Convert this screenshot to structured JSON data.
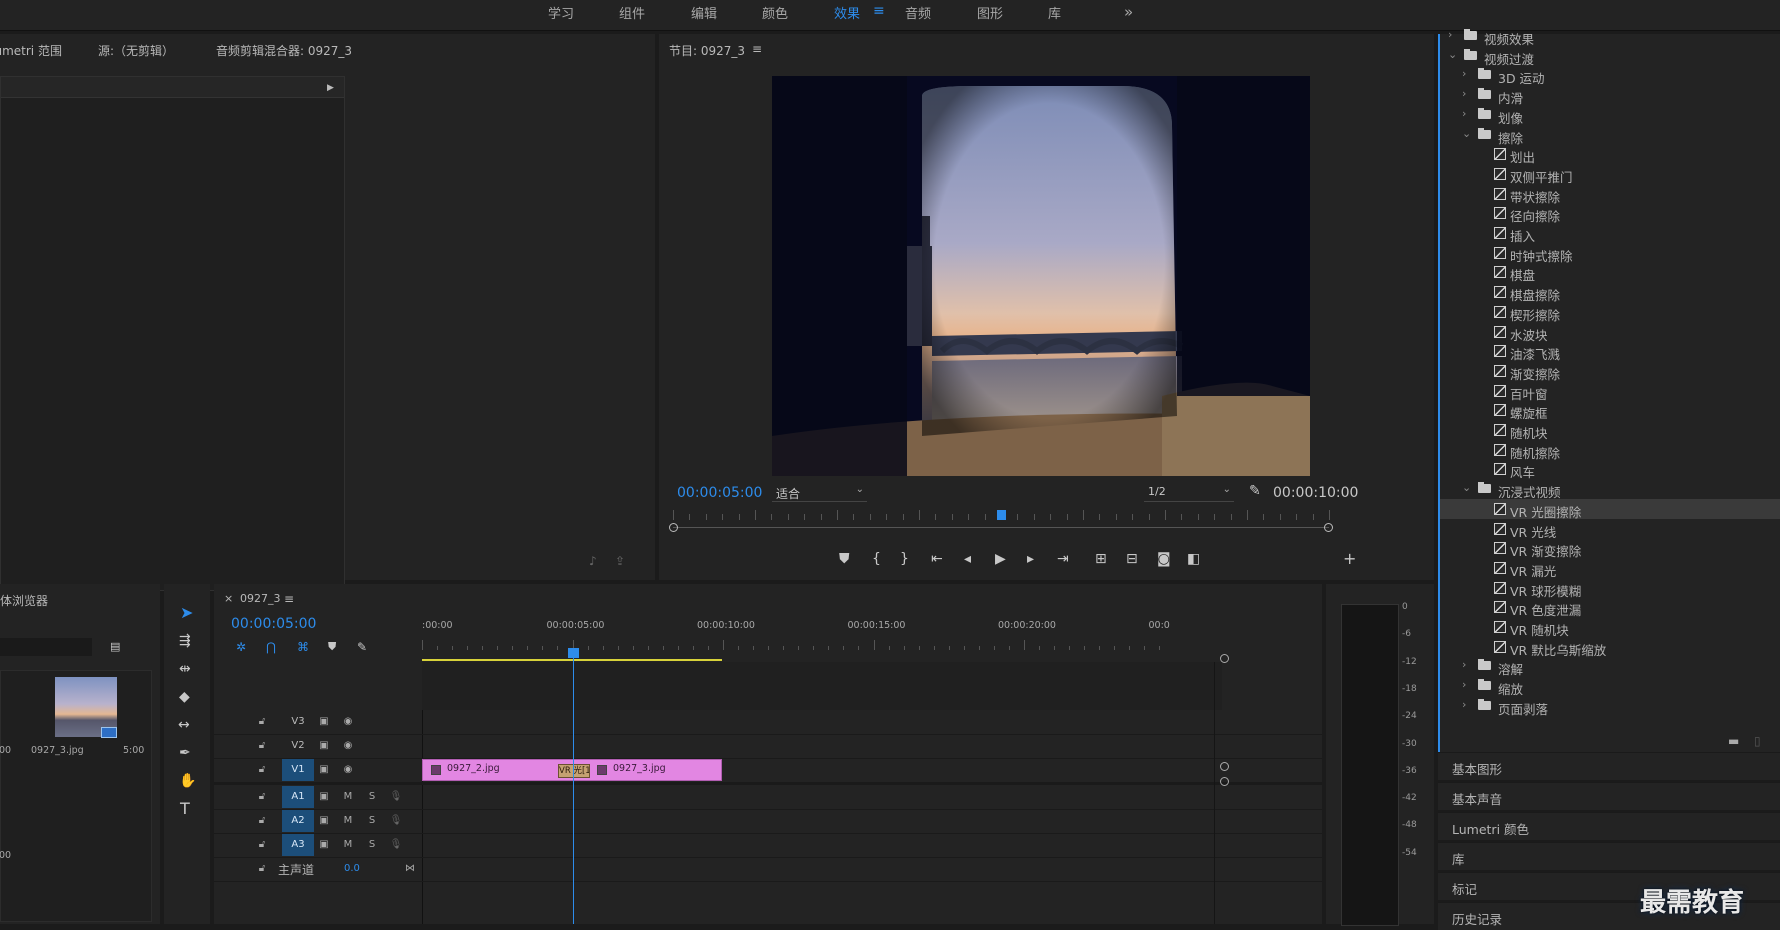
{
  "workspace_tabs": [
    "学习",
    "组件",
    "编辑",
    "颜色",
    "效果",
    "音频",
    "图形",
    "库"
  ],
  "active_workspace": "效果",
  "more_glyph": "»",
  "menu_glyph": "≡",
  "source_panel": {
    "tabs": [
      "Lumetri 范围",
      "源:（无剪辑）",
      "音频剪辑混合器: 0927_3"
    ]
  },
  "program_monitor": {
    "title": "节目: 0927_3",
    "current_time": "00:00:05:00",
    "fit_label": "适合",
    "resolution": "1/2",
    "duration": "00:00:10:00",
    "playhead_fraction": 0.5
  },
  "media_browser": {
    "title": "媒体浏览器",
    "item_name": "0927_3.jpg",
    "item_duration": "5:00",
    "left_dur": "00",
    "left_dur2": "00"
  },
  "timeline": {
    "tab_label": "0927_3",
    "close_glyph": "×",
    "current_time": "00:00:05:00",
    "ruler_labels": [
      ":00:00",
      "00:00:05:00",
      "00:00:10:00",
      "00:00:15:00",
      "00:00:20:00",
      "00:0"
    ],
    "tracks": [
      {
        "name": "V3",
        "type": "video",
        "target": false
      },
      {
        "name": "V2",
        "type": "video",
        "target": false
      },
      {
        "name": "V1",
        "type": "video",
        "target": true
      },
      {
        "name": "A1",
        "type": "audio",
        "target": true
      },
      {
        "name": "A2",
        "type": "audio",
        "target": true
      },
      {
        "name": "A3",
        "type": "audio",
        "target": true
      }
    ],
    "master_label": "主声道",
    "master_value": "0.0",
    "mute_label": "M",
    "solo_label": "S",
    "clips": [
      {
        "name": "0927_2.jpg",
        "track": "V1"
      },
      {
        "name": "0927_3.jpg",
        "track": "V1"
      }
    ],
    "transition_label": "VR 光",
    "transition_tail": "[1"
  },
  "audio_meter": {
    "scale": [
      "0",
      "-6",
      "-12",
      "-18",
      "-24",
      "-30",
      "-36",
      "-42",
      "-48",
      "-54"
    ]
  },
  "effects_tree": [
    {
      "level": 1,
      "type": "folder",
      "label": "视频效果",
      "expanded": false,
      "partial": true
    },
    {
      "level": 1,
      "type": "folder",
      "label": "视频过渡",
      "expanded": true
    },
    {
      "level": 2,
      "type": "folder",
      "label": "3D 运动",
      "expanded": false
    },
    {
      "level": 2,
      "type": "folder",
      "label": "内滑",
      "expanded": false
    },
    {
      "level": 2,
      "type": "folder",
      "label": "划像",
      "expanded": false
    },
    {
      "level": 2,
      "type": "folder",
      "label": "擦除",
      "expanded": true
    },
    {
      "level": 3,
      "type": "fx",
      "label": "划出"
    },
    {
      "level": 3,
      "type": "fx",
      "label": "双侧平推门"
    },
    {
      "level": 3,
      "type": "fx",
      "label": "带状擦除"
    },
    {
      "level": 3,
      "type": "fx",
      "label": "径向擦除"
    },
    {
      "level": 3,
      "type": "fx",
      "label": "插入"
    },
    {
      "level": 3,
      "type": "fx",
      "label": "时钟式擦除"
    },
    {
      "level": 3,
      "type": "fx",
      "label": "棋盘"
    },
    {
      "level": 3,
      "type": "fx",
      "label": "棋盘擦除"
    },
    {
      "level": 3,
      "type": "fx",
      "label": "楔形擦除"
    },
    {
      "level": 3,
      "type": "fx",
      "label": "水波块"
    },
    {
      "level": 3,
      "type": "fx",
      "label": "油漆飞溅"
    },
    {
      "level": 3,
      "type": "fx",
      "label": "渐变擦除"
    },
    {
      "level": 3,
      "type": "fx",
      "label": "百叶窗"
    },
    {
      "level": 3,
      "type": "fx",
      "label": "螺旋框"
    },
    {
      "level": 3,
      "type": "fx",
      "label": "随机块"
    },
    {
      "level": 3,
      "type": "fx",
      "label": "随机擦除"
    },
    {
      "level": 3,
      "type": "fx",
      "label": "风车"
    },
    {
      "level": 2,
      "type": "folder",
      "label": "沉浸式视频",
      "expanded": true
    },
    {
      "level": 3,
      "type": "fx",
      "label": "VR 光圈擦除",
      "selected": true
    },
    {
      "level": 3,
      "type": "fx",
      "label": "VR 光线"
    },
    {
      "level": 3,
      "type": "fx",
      "label": "VR 渐变擦除"
    },
    {
      "level": 3,
      "type": "fx",
      "label": "VR 漏光"
    },
    {
      "level": 3,
      "type": "fx",
      "label": "VR 球形模糊"
    },
    {
      "level": 3,
      "type": "fx",
      "label": "VR 色度泄漏"
    },
    {
      "level": 3,
      "type": "fx",
      "label": "VR 随机块"
    },
    {
      "level": 3,
      "type": "fx",
      "label": "VR 默比乌斯缩放"
    },
    {
      "level": 2,
      "type": "folder",
      "label": "溶解",
      "expanded": false
    },
    {
      "level": 2,
      "type": "folder",
      "label": "缩放",
      "expanded": false
    },
    {
      "level": 2,
      "type": "folder",
      "label": "页面剥落",
      "expanded": false
    }
  ],
  "side_panels": [
    "基本图形",
    "基本声音",
    "Lumetri 颜色",
    "库",
    "标记",
    "历史记录"
  ],
  "watermark": "最需教育"
}
